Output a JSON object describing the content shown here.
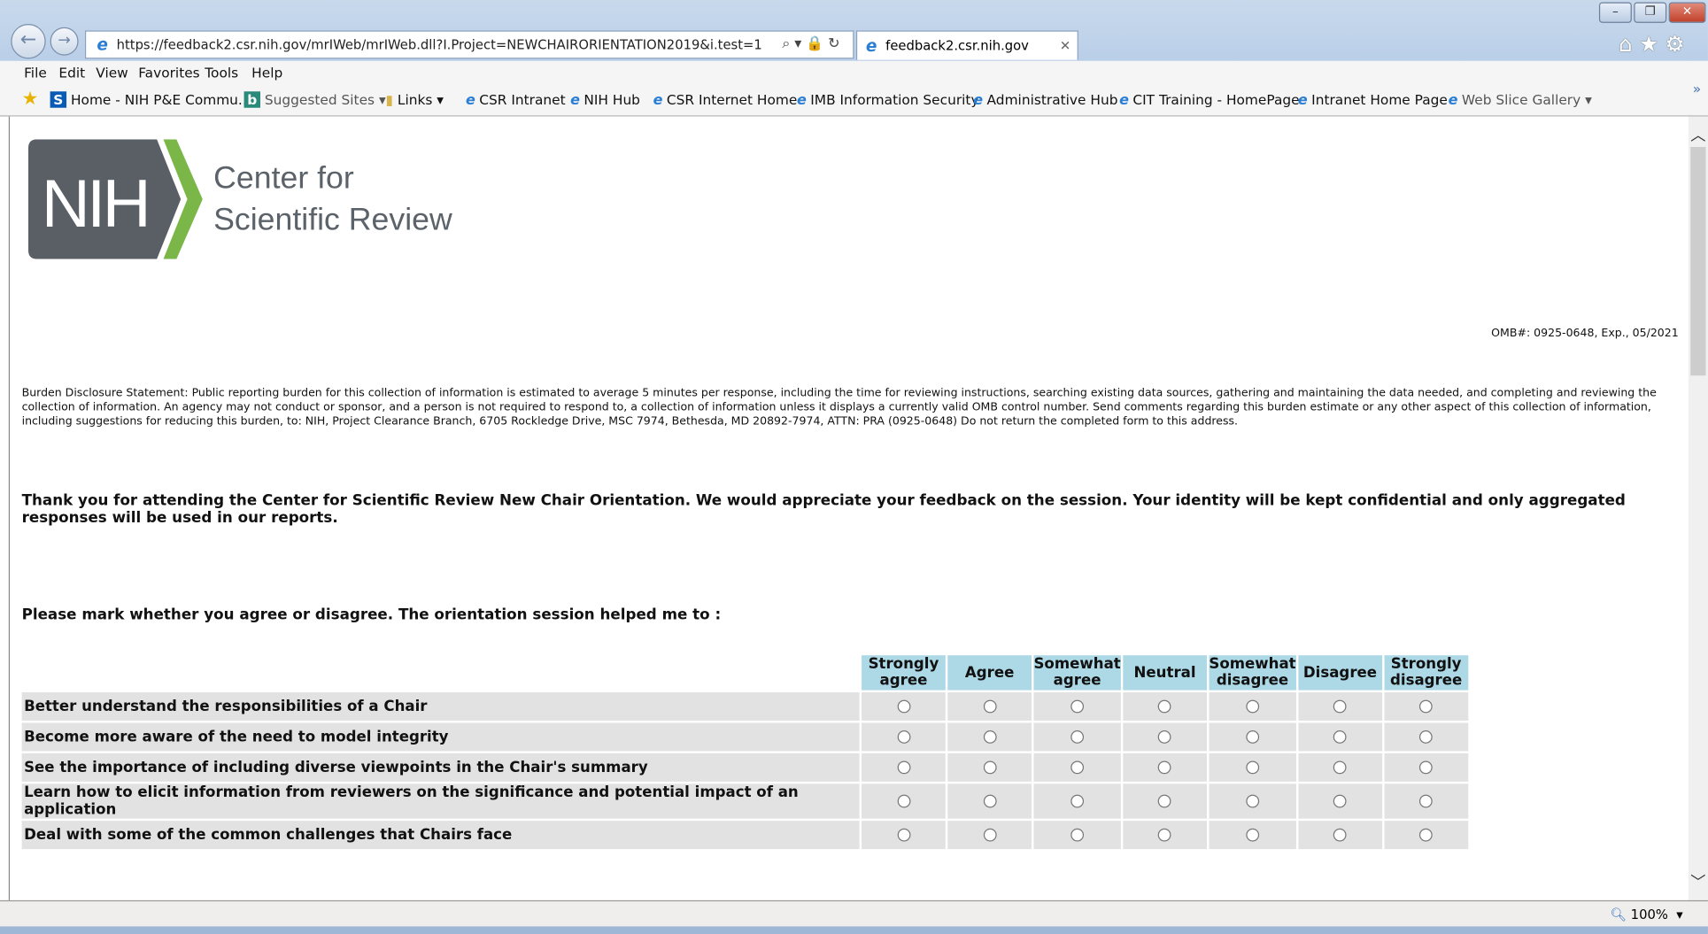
{
  "browser": {
    "url": "https://feedback2.csr.nih.gov/mrIWeb/mrIWeb.dll?I.Project=NEWCHAIRORIENTATION2019&i.test=1",
    "tab_title": "feedback2.csr.nih.gov",
    "menu": [
      "File",
      "Edit",
      "View",
      "Favorites",
      "Tools",
      "Help"
    ],
    "favorites": [
      "Home - NIH P&E Commu...",
      "Suggested Sites",
      "Links",
      "CSR Intranet",
      "NIH Hub",
      "CSR Internet Home",
      "IMB Information Security",
      "Administrative Hub",
      "CIT Training - HomePage",
      "Intranet Home Page",
      "Web Slice Gallery"
    ],
    "zoom": "100%"
  },
  "logo": {
    "mark": "NIH",
    "line1": "Center for",
    "line2": "Scientific Review"
  },
  "omb": "OMB#: 0925-0648, Exp., 05/2021",
  "burden": "Burden Disclosure Statement: Public reporting burden for this collection of information is estimated to average 5 minutes per response, including the time for reviewing instructions, searching existing data sources, gathering and maintaining the data needed, and completing and reviewing the collection of information. An agency may not conduct or sponsor, and a person is not required to respond to, a collection of information unless it displays a currently valid OMB control number. Send comments regarding this burden estimate or any other aspect of this collection of information, including suggestions for reducing this burden, to: NIH, Project Clearance Branch, 6705 Rockledge Drive, MSC 7974, Bethesda, MD 20892-7974, ATTN: PRA (0925-0648) Do not return the completed form to this address.",
  "intro": "Thank you for attending the Center for Scientific Review New Chair Orientation. We would appreciate your feedback on the session. Your identity will be kept confidential and only aggregated responses will be used in our reports.",
  "question": "Please mark whether you agree or disagree. The orientation session helped me to :",
  "columns": [
    [
      "Strongly",
      "agree"
    ],
    [
      "Agree",
      ""
    ],
    [
      "Somewhat",
      "agree"
    ],
    [
      "Neutral",
      ""
    ],
    [
      "Somewhat",
      "disagree"
    ],
    [
      "Disagree",
      ""
    ],
    [
      "Strongly",
      "disagree"
    ]
  ],
  "rows": [
    "Better understand the responsibilities of a Chair",
    "Become more aware of the need to model integrity",
    "See the importance of including diverse viewpoints in the Chair's summary",
    "Learn how to elicit information from reviewers on the significance and potential impact of an application",
    "Deal with some of the common challenges that Chairs face"
  ]
}
